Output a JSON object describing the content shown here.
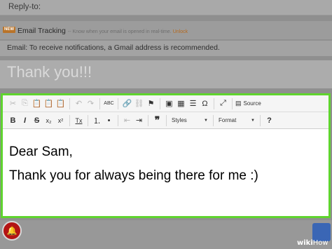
{
  "reply_to": {
    "label": "Reply-to:"
  },
  "tracking": {
    "badge": "NEW",
    "title": "Email Tracking",
    "description": "-- Know when your email is opened in real-time.",
    "unlock": "Unlock"
  },
  "notice": "Email: To receive notifications, a Gmail address is recommended.",
  "subject": {
    "value": "Thank you!!!"
  },
  "toolbar": {
    "row1": {
      "cut": "✂",
      "copy": "⎘",
      "paste": "📋",
      "paste_text": "📋",
      "paste_word": "📋",
      "undo": "↶",
      "redo": "↷",
      "spellcheck": "ABC",
      "link": "🔗",
      "unlink": "⛓",
      "anchor": "⚑",
      "image": "▣",
      "table": "▦",
      "hr": "☰",
      "special_char": "Ω",
      "maximize": "⤢",
      "source_icon": "▤",
      "source_label": "Source"
    },
    "row2": {
      "bold": "B",
      "italic": "I",
      "strike": "S",
      "subscript": "x₂",
      "superscript": "x²",
      "remove_format": "Tx",
      "numbered_list": "⒈",
      "bulleted_list": "•",
      "outdent": "⇤",
      "indent": "⇥",
      "blockquote": "❞",
      "styles_label": "Styles",
      "format_label": "Format",
      "help": "?"
    }
  },
  "body": {
    "line1": "Dear Sam,",
    "line2": "Thank you for always being there for me :)"
  },
  "watermark": {
    "wiki": "wiki",
    "how": "How"
  }
}
